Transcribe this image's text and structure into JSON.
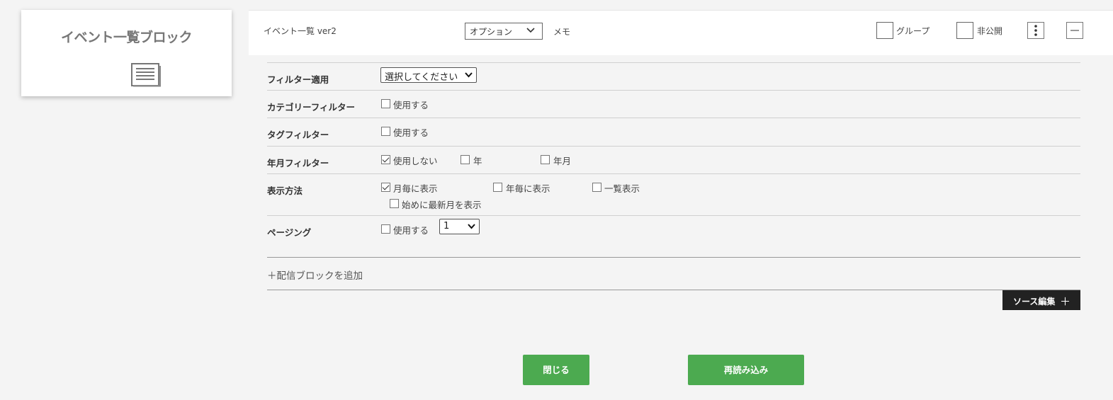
{
  "block_card": {
    "title": "イベント一覧ブロック",
    "icon": "document-list-icon"
  },
  "header": {
    "title": "イベント一覧 ver2",
    "option_select": "オプション",
    "memo": "メモ",
    "group_label": "グループ",
    "private_label": "非公開"
  },
  "form": {
    "filter_apply": {
      "label": "フィルター適用",
      "select_value": "選択してください"
    },
    "category_filter": {
      "label": "カテゴリーフィルター",
      "use_label": "使用する"
    },
    "tag_filter": {
      "label": "タグフィルター",
      "use_label": "使用する"
    },
    "yearmonth_filter": {
      "label": "年月フィルター",
      "options": [
        "使用しない",
        "年",
        "年月"
      ]
    },
    "display_method": {
      "label": "表示方法",
      "options": [
        "月毎に表示",
        "年毎に表示",
        "一覧表示"
      ],
      "sub_option": "始めに最新月を表示"
    },
    "paging": {
      "label": "ページング",
      "use_label": "使用する",
      "select_value": "1"
    }
  },
  "add_delivery_block": "＋配信ブロックを追加",
  "source_edit": {
    "label": "ソース編集",
    "plus": "＋"
  },
  "buttons": {
    "close": "閉じる",
    "reload": "再読み込み"
  }
}
